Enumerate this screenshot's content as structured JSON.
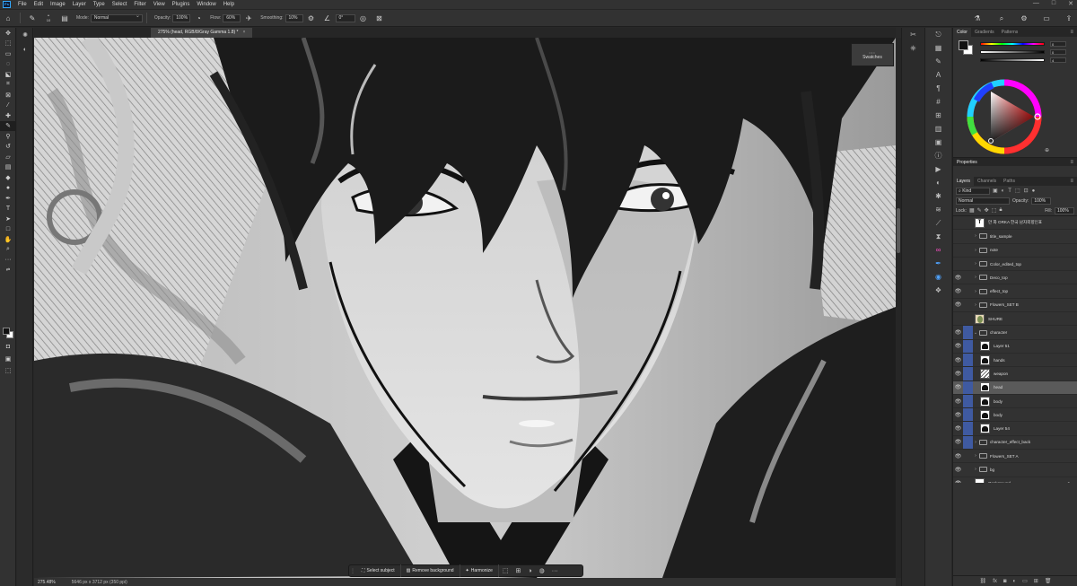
{
  "menu": {
    "app_logo": "Ps",
    "items": [
      "File",
      "Edit",
      "Image",
      "Layer",
      "Type",
      "Select",
      "Filter",
      "View",
      "Plugins",
      "Window",
      "Help"
    ],
    "window_controls": [
      "—",
      "□",
      "✕"
    ]
  },
  "options": {
    "brush_size": "10",
    "mode_label": "Mode:",
    "mode_value": "Normal",
    "opacity_label": "Opacity:",
    "opacity_value": "100%",
    "flow_label": "Flow:",
    "flow_value": "60%",
    "smoothing_label": "Smoothing:",
    "smoothing_value": "10%",
    "angle_value": "0°"
  },
  "document": {
    "tab_title": "275% (head, RGB/8/Gray Gamma 1.8) *",
    "tab_close": "×",
    "zoom": "275.48%",
    "dimensions": "5646 px x 3712 px (350 ppi)"
  },
  "floating_panel": {
    "swatches_label": "Swatches"
  },
  "taskbar": {
    "select_subject": "Select subject",
    "remove_background": "Remove background",
    "harmonize": "Harmonize"
  },
  "color_panel": {
    "tabs": [
      "Color",
      "Gradients",
      "Patterns"
    ],
    "slider_values": [
      "0",
      "0",
      "4"
    ]
  },
  "properties": {
    "title": "Properties"
  },
  "layers_panel": {
    "tabs": [
      "Layers",
      "Channels",
      "Paths"
    ],
    "filter_kind": "Kind",
    "blend_mode": "Normal",
    "opacity_label": "Opacity:",
    "opacity_value": "100%",
    "lock_label": "Lock:",
    "fill_label": "Fill:",
    "fill_value": "100%",
    "layers": [
      {
        "name": "만 화 ORKA  한국 남자외향인표",
        "type": "text",
        "visible": false,
        "indent": 0,
        "linked": false
      },
      {
        "name": "title_sample",
        "type": "folder",
        "visible": false,
        "indent": 0,
        "linked": false
      },
      {
        "name": "note",
        "type": "folder",
        "visible": false,
        "indent": 0,
        "linked": false
      },
      {
        "name": "Color_edited_top",
        "type": "folder",
        "visible": false,
        "indent": 0,
        "linked": false
      },
      {
        "name": "Deco_top",
        "type": "folder",
        "visible": true,
        "indent": 0,
        "linked": false
      },
      {
        "name": "effect_top",
        "type": "folder",
        "visible": true,
        "indent": 0,
        "linked": false
      },
      {
        "name": "Flowers_SET B",
        "type": "folder",
        "visible": true,
        "indent": 0,
        "linked": false
      },
      {
        "name": "SHURE",
        "type": "flower",
        "visible": false,
        "indent": 0,
        "linked": false
      },
      {
        "name": "character",
        "type": "folder-open",
        "visible": true,
        "indent": 0,
        "linked": true
      },
      {
        "name": "Layer 51",
        "type": "dark",
        "visible": true,
        "indent": 1,
        "linked": true
      },
      {
        "name": "hands",
        "type": "dark",
        "visible": true,
        "indent": 1,
        "linked": true
      },
      {
        "name": "weapon",
        "type": "hatch",
        "visible": true,
        "indent": 1,
        "linked": true
      },
      {
        "name": "head",
        "type": "dark",
        "visible": true,
        "indent": 1,
        "linked": true,
        "selected": true
      },
      {
        "name": "body",
        "type": "dark",
        "visible": true,
        "indent": 1,
        "linked": true
      },
      {
        "name": "body",
        "type": "dark",
        "visible": true,
        "indent": 1,
        "linked": true
      },
      {
        "name": "Layer 54",
        "type": "dark",
        "visible": true,
        "indent": 1,
        "linked": true
      },
      {
        "name": "character_effect_back",
        "type": "folder",
        "visible": true,
        "indent": 0,
        "linked": true
      },
      {
        "name": "Flowers_SET A",
        "type": "folder",
        "visible": true,
        "indent": 0,
        "linked": false
      },
      {
        "name": "bg",
        "type": "folder",
        "visible": true,
        "indent": 0,
        "linked": false
      },
      {
        "name": "Background",
        "type": "background",
        "visible": true,
        "indent": 0,
        "linked": false,
        "locked": true
      }
    ]
  },
  "colors": {
    "accent": "#31a8ff",
    "link_highlight": "#3f5aa1",
    "panel_bg": "#323232"
  }
}
